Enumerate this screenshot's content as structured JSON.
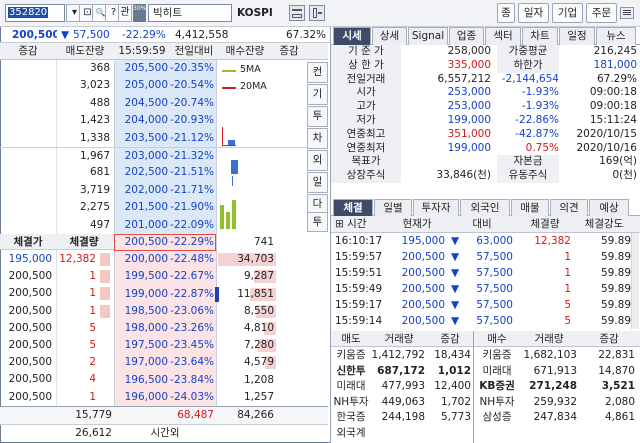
{
  "toolbar": {
    "code": "352820",
    "btn_labels": [
      "▾",
      "⊡",
      "🔍",
      "?",
      "관"
    ],
    "badge": "30%",
    "name": "빅히트",
    "market": "KOSPI",
    "right_buttons": [
      "종",
      "일자",
      "기업",
      "주문"
    ]
  },
  "summary": {
    "price": "200,500",
    "arrow": "▼",
    "change": "57,500",
    "pct": "-22.29%",
    "volume": "4,412,558",
    "ratio": "67.32%"
  },
  "orderbook": {
    "headers": [
      "증감",
      "매도잔량",
      "15:59:59",
      "전일대비",
      "매수잔량",
      "증감"
    ],
    "asks": [
      {
        "qty": "368",
        "price": "205,500",
        "rate": "-20.35%"
      },
      {
        "qty": "3,023",
        "price": "205,000",
        "rate": "-20.54%"
      },
      {
        "qty": "488",
        "price": "204,500",
        "rate": "-20.74%"
      },
      {
        "qty": "1,423",
        "price": "204,000",
        "rate": "-20.93%"
      },
      {
        "qty": "1,338",
        "price": "203,500",
        "rate": "-21.12%"
      },
      {
        "qty": "1,967",
        "price": "203,000",
        "rate": "-21.32%"
      },
      {
        "qty": "681",
        "price": "202,500",
        "rate": "-21.51%"
      },
      {
        "qty": "3,719",
        "price": "202,000",
        "rate": "-21.71%"
      },
      {
        "qty": "2,275",
        "price": "201,500",
        "rate": "-21.90%"
      },
      {
        "qty": "497",
        "price": "201,000",
        "rate": "-22.09%"
      }
    ],
    "bids": [
      {
        "price": "200,500",
        "rate": "-22.29%",
        "qty": "741"
      },
      {
        "price": "200,000",
        "rate": "-22.48%",
        "qty": "34,703"
      },
      {
        "price": "199,500",
        "rate": "-22.67%",
        "qty": "9,287"
      },
      {
        "price": "199,000",
        "rate": "-22.87%",
        "qty": "11,851"
      },
      {
        "price": "198,500",
        "rate": "-23.06%",
        "qty": "8,550"
      },
      {
        "price": "198,000",
        "rate": "-23.26%",
        "qty": "4,810"
      },
      {
        "price": "197,500",
        "rate": "-23.45%",
        "qty": "7,280"
      },
      {
        "price": "197,000",
        "rate": "-23.64%",
        "qty": "4,579"
      },
      {
        "price": "196,500",
        "rate": "-23.84%",
        "qty": "1,208"
      },
      {
        "price": "196,000",
        "rate": "-24.03%",
        "qty": "1,257"
      }
    ],
    "legend_5ma": "5MA",
    "legend_20ma": "20MA",
    "side_tabs": [
      "컨",
      "기",
      "투",
      "차",
      "외",
      "일",
      "다",
      "투"
    ],
    "trade_headers": [
      "체결가",
      "체결량"
    ],
    "trades": [
      {
        "price": "195,000",
        "qty": "12,382"
      },
      {
        "price": "200,500",
        "qty": "1"
      },
      {
        "price": "200,500",
        "qty": "1"
      },
      {
        "price": "200,500",
        "qty": "1"
      },
      {
        "price": "200,500",
        "qty": "5"
      },
      {
        "price": "200,500",
        "qty": "5"
      },
      {
        "price": "200,500",
        "qty": "2"
      },
      {
        "price": "200,500",
        "qty": "4"
      },
      {
        "price": "200,500",
        "qty": "1"
      }
    ],
    "total_ask": "15,779",
    "total_diff": "68,487",
    "total_bid": "84,266",
    "after_qty": "26,612",
    "after_label": "시간외"
  },
  "right": {
    "tabs": [
      "시세",
      "상세",
      "Signal",
      "업종",
      "섹터",
      "차트",
      "일정",
      "뉴스"
    ],
    "info": [
      {
        "l": "기 준 가",
        "v": "258,000",
        "v2": "",
        "v3": "",
        "l2": "가중평균",
        "v4": "216,245"
      },
      {
        "l": "상 한 가",
        "v": "335,000",
        "v2": "",
        "v3": "",
        "l2": "하한가",
        "v4": "181,000"
      },
      {
        "l": "전일거래",
        "v": "6,557,212",
        "v2": "-2,144,654",
        "v3": "",
        "l2": "",
        "v4": "67.29%"
      },
      {
        "l": "시가",
        "v": "253,000",
        "v2": "-1.93%",
        "v3": "",
        "l2": "",
        "v4": "09:00:18"
      },
      {
        "l": "고가",
        "v": "253,000",
        "v2": "-1.93%",
        "v3": "",
        "l2": "",
        "v4": "09:00:18"
      },
      {
        "l": "저가",
        "v": "199,000",
        "v2": "-22.86%",
        "v3": "",
        "l2": "",
        "v4": "15:11:24"
      },
      {
        "l": "연중최고",
        "v": "351,000",
        "v2": "-42.87%",
        "v3": "",
        "l2": "",
        "v4": "2020/10/15"
      },
      {
        "l": "연중최저",
        "v": "199,000",
        "v2": "0.75%",
        "v3": "",
        "l2": "",
        "v4": "2020/10/16"
      },
      {
        "l": "목표가",
        "v": "",
        "v2": "",
        "v3": "",
        "l2": "자본금",
        "v4": "169(억)"
      },
      {
        "l": "상장주식",
        "v": "33,846(천)",
        "v2": "",
        "v3": "",
        "l2": "유동주식",
        "v4": "0(천)"
      }
    ],
    "subtabs": [
      "체결",
      "일별",
      "투자자",
      "외국인",
      "매물",
      "의견",
      "예상"
    ],
    "trade_headers": [
      "시간",
      "현재가",
      "대비",
      "체결량",
      "체결강도"
    ],
    "trades": [
      {
        "t": "16:10:17",
        "p": "195,000",
        "a": "▼",
        "d": "63,000",
        "q": "12,382",
        "s": "59.89"
      },
      {
        "t": "15:59:57",
        "p": "200,500",
        "a": "▼",
        "d": "57,500",
        "q": "1",
        "s": "59.89"
      },
      {
        "t": "15:59:51",
        "p": "200,500",
        "a": "▼",
        "d": "57,500",
        "q": "1",
        "s": "59.89"
      },
      {
        "t": "15:59:49",
        "p": "200,500",
        "a": "▼",
        "d": "57,500",
        "q": "1",
        "s": "59.89"
      },
      {
        "t": "15:59:17",
        "p": "200,500",
        "a": "▼",
        "d": "57,500",
        "q": "5",
        "s": "59.89"
      },
      {
        "t": "15:59:14",
        "p": "200,500",
        "a": "▼",
        "d": "57,500",
        "q": "5",
        "s": "59.89"
      }
    ],
    "broker_headers": [
      "매도",
      "거래량",
      "증감",
      "매수",
      "거래량",
      "증감"
    ],
    "brokers": [
      {
        "s": "키움증",
        "sv": "1,412,792",
        "sc": "18,434",
        "b": "키움증",
        "bv": "1,682,103",
        "bc": "22,831"
      },
      {
        "s": "신한투",
        "sv": "687,172",
        "sc": "1,012",
        "b": "미래대",
        "bv": "671,913",
        "bc": "14,870"
      },
      {
        "s": "미래대",
        "sv": "477,993",
        "sc": "12,400",
        "b": "KB증권",
        "bv": "271,248",
        "bc": "3,521"
      },
      {
        "s": "NH투자",
        "sv": "449,063",
        "sc": "1,702",
        "b": "NH투자",
        "bv": "259,932",
        "bc": "2,080"
      },
      {
        "s": "한국증",
        "sv": "244,198",
        "sc": "5,773",
        "b": "삼성증",
        "bv": "247,834",
        "bc": "4,861"
      }
    ],
    "foreign_label": "외국계"
  },
  "colors": {
    "blue": "#1542c9",
    "red": "#d41818",
    "ask_bg": "#dbe8f8",
    "bid_bg": "#fbe3e6",
    "tab_active": "#3e4c6a"
  }
}
